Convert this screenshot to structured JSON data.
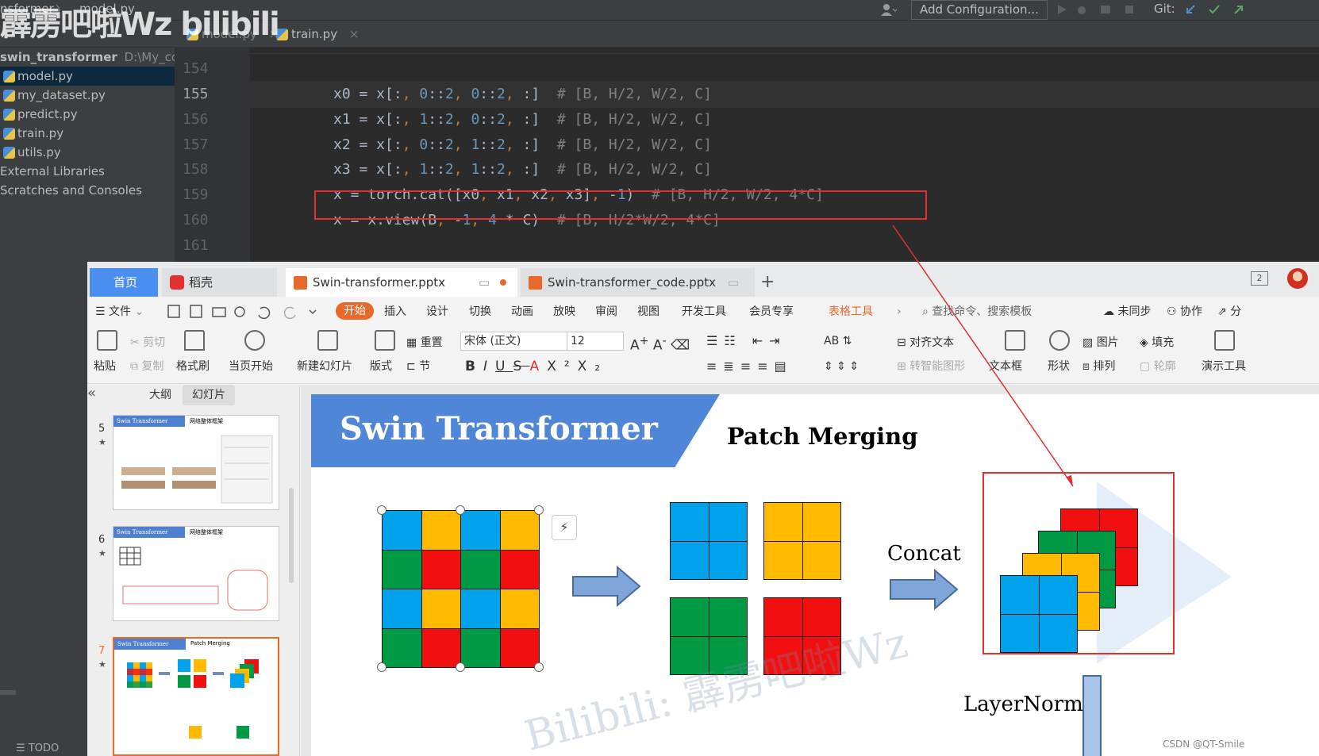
{
  "ide": {
    "top_bar": {
      "breadcrumb_project": "nsformer",
      "breadcrumb_sep": "〉",
      "breadcrumb_file": "model.py",
      "add_configuration": "Add Configuration...",
      "git_label": "Git:"
    },
    "overlay_watermark": "霹雳吧啦Wz bilibili",
    "tabs": [
      {
        "label": "model.py"
      },
      {
        "label": "train.py"
      }
    ],
    "project_root": {
      "name": "swin_transformer",
      "path": "D:\\My_code"
    },
    "files": [
      "model.py",
      "my_dataset.py",
      "predict.py",
      "train.py",
      "utils.py"
    ],
    "tree_extra": [
      "External Libraries",
      "Scratches and Consoles"
    ],
    "bottom_tab": "TODO",
    "line_numbers": [
      "154",
      "155",
      "156",
      "157",
      "158",
      "159",
      "160",
      "161"
    ],
    "code_lines": [
      {
        "code": "x0 = x[:, 0::2, 0::2, :]",
        "comment": "# [B, H/2, W/2, C]"
      },
      {
        "code": "x1 = x[:, 1::2, 0::2, :]",
        "comment": "# [B, H/2, W/2, C]"
      },
      {
        "code": "x2 = x[:, 0::2, 1::2, :]",
        "comment": "# [B, H/2, W/2, C]"
      },
      {
        "code": "x3 = x[:, 1::2, 1::2, :]",
        "comment": "# [B, H/2, W/2, C]"
      },
      {
        "code": "x = torch.cat([x0, x1, x2, x3], -1)",
        "comment": "# [B, H/2, W/2, 4*C]"
      },
      {
        "code": "x = x.view(B, -1, 4 * C)",
        "comment": "# [B, H/2*W/2, 4*C]"
      }
    ],
    "colors": {
      "highlight_border": "#e03030",
      "number": "#6897bb",
      "comment": "#808080"
    }
  },
  "wps": {
    "tabs": {
      "home": "首页",
      "docer": "稻壳",
      "file1": "Swin-transformer.pptx",
      "file2": "Swin-transformer_code.pptx",
      "add": "+"
    },
    "menu": {
      "file": "文件",
      "items": [
        "开始",
        "插入",
        "设计",
        "切换",
        "动画",
        "放映",
        "审阅",
        "视图",
        "开发工具",
        "会员专享",
        "表格工具"
      ],
      "search": "查找命令、搜索模板",
      "unsynced": "未同步",
      "collab": "协作",
      "share": "分"
    },
    "ribbon": {
      "paste": "粘贴",
      "cut": "剪切",
      "copy": "复制",
      "format_painter": "格式刷",
      "from_current": "当页开始",
      "new_slide": "新建幻灯片",
      "layout": "版式",
      "reset": "重置",
      "section": "节",
      "font_name": "宋体 (正文)",
      "font_size": "12",
      "align_text": "对齐文本",
      "smart_art": "转智能图形",
      "textbox": "文本框",
      "shape": "形状",
      "picture": "图片",
      "arrange": "排列",
      "fill": "填充",
      "outline": "轮廓",
      "presenter": "演示工具"
    },
    "panel": {
      "collapse": "«",
      "outline_tab": "大纲",
      "slides_tab": "幻灯片",
      "slides": [
        {
          "num": "5",
          "title": "Swin Transformer",
          "subtitle": "网络整体框架"
        },
        {
          "num": "6",
          "title": "Swin Transformer",
          "subtitle": "网络整体框架"
        },
        {
          "num": "7",
          "title": "Swin Transformer",
          "subtitle": "Patch Merging"
        }
      ]
    },
    "slide": {
      "title": "Swin Transformer",
      "subtitle": "Patch Merging",
      "concat_label": "Concat",
      "layernorm_label": "LayerNorm",
      "watermark": "Bilibili: 霹雳吧啦Wz",
      "grid_4x4": [
        [
          "B",
          "Y",
          "B",
          "Y"
        ],
        [
          "G",
          "R",
          "G",
          "R"
        ],
        [
          "B",
          "Y",
          "B",
          "Y"
        ],
        [
          "G",
          "R",
          "G",
          "R"
        ]
      ],
      "colors": {
        "blue": "#00a2ec",
        "yellow": "#ffba00",
        "red": "#f20f0f",
        "green": "#009944",
        "title_bar": "#4f86d8",
        "box": "#e03030"
      }
    },
    "credit": "CSDN @QT-Smile"
  }
}
